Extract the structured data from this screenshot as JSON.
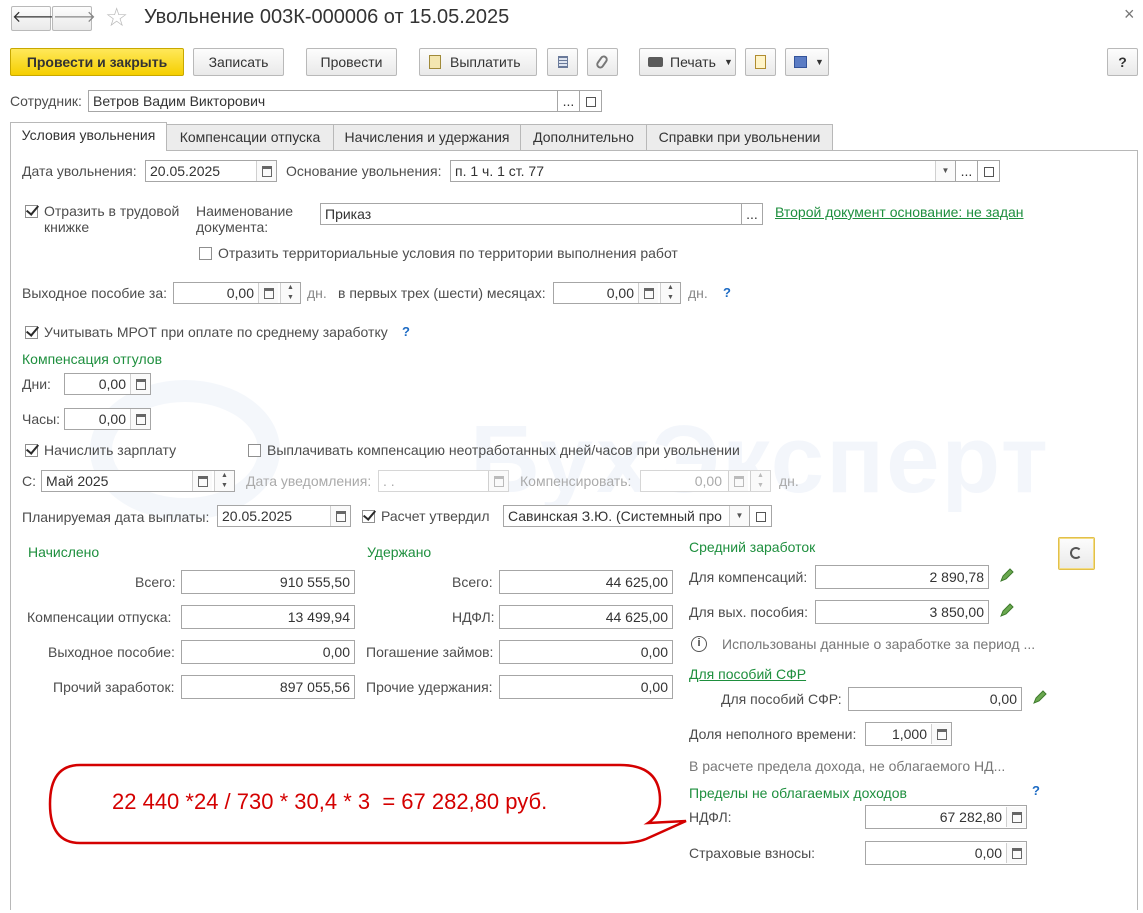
{
  "window": {
    "title": "Увольнение 003К-000006 от 15.05.2025",
    "close": "×"
  },
  "toolbar": {
    "post_close": "Провести и закрыть",
    "save": "Записать",
    "post": "Провести",
    "pay": "Выплатить",
    "print": "Печать",
    "help": "?"
  },
  "employee": {
    "label": "Сотрудник:",
    "value": "Ветров Вадим Викторович",
    "dots": "..."
  },
  "tabs": [
    "Условия увольнения",
    "Компенсации отпуска",
    "Начисления и удержания",
    "Дополнительно",
    "Справки при увольнении"
  ],
  "dismissal": {
    "date_label": "Дата увольнения:",
    "date": "20.05.2025",
    "reason_label": "Основание увольнения:",
    "reason": "п. 1 ч. 1 ст. 77"
  },
  "workbook": {
    "label1": "Отразить в трудовой",
    "label2": "книжке",
    "doc_label1": "Наименование",
    "doc_label2": "документа:",
    "doc": "Приказ",
    "second_doc": "Второй документ основание: не задан",
    "territorial": "Отразить территориальные условия по территории выполнения работ"
  },
  "severance": {
    "label": "Выходное пособие за:",
    "value": "0,00",
    "unit": "дн.",
    "first_label": "в первых трех (шести) месяцах:",
    "first_value": "0,00",
    "unit2": "дн.",
    "help": "?"
  },
  "mrot": {
    "label": "Учитывать МРОТ при оплате по среднему заработку",
    "help": "?"
  },
  "comp_off": {
    "title": "Компенсация отгулов",
    "days_label": "Дни:",
    "days": "0,00",
    "hours_label": "Часы:",
    "hours": "0,00"
  },
  "salary": {
    "accrue": "Начислить зарплату",
    "pay_unworked": "Выплачивать компенсацию неотработанных дней/часов при увольнении",
    "from_label": "С:",
    "month": "Май 2025",
    "notice_label": "Дата уведомления:",
    "notice": " .  .",
    "compensate_label": "Компенсировать:",
    "compensate": "0,00",
    "unit": "дн."
  },
  "payment": {
    "label": "Планируемая дата выплаты:",
    "date": "20.05.2025",
    "approved": "Расчет утвердил",
    "approver": "Савинская З.Ю. (Системный про"
  },
  "accrued": {
    "title": "Начислено",
    "rows": [
      {
        "label": "Всего:",
        "value": "910 555,50"
      },
      {
        "label": "Компенсации отпуска:",
        "value": "13 499,94"
      },
      {
        "label": "Выходное пособие:",
        "value": "0,00"
      },
      {
        "label": "Прочий заработок:",
        "value": "897 055,56"
      }
    ]
  },
  "withheld": {
    "title": "Удержано",
    "rows": [
      {
        "label": "Всего:",
        "value": "44 625,00"
      },
      {
        "label": "НДФЛ:",
        "value": "44 625,00"
      },
      {
        "label": "Погашение займов:",
        "value": "0,00"
      },
      {
        "label": "Прочие удержания:",
        "value": "0,00"
      }
    ]
  },
  "avg": {
    "title": "Средний заработок",
    "comp_label": "Для компенсаций:",
    "comp": "2 890,78",
    "sev_label": "Для вых. пособия:",
    "sev": "3 850,00",
    "info": "Использованы данные о заработке за период ...",
    "sfr_link": "Для пособий СФР",
    "sfr_label": "Для пособий СФР:",
    "sfr": "0,00",
    "part_label": "Доля неполного времени:",
    "part": "1,000",
    "limit_note": "В расчете предела дохода, не облагаемого НД..."
  },
  "limits": {
    "title": "Пределы не облагаемых доходов",
    "help": "?",
    "ndfl_label": "НДФЛ:",
    "ndfl": "67 282,80",
    "ins_label": "Страховые взносы:",
    "ins": "0,00"
  },
  "callout": {
    "text": "22 440 *24 / 730 * 30,4 * 3  = 67 282,80 руб.",
    "color": "#d40000"
  },
  "watermark": "БухЭксперт"
}
